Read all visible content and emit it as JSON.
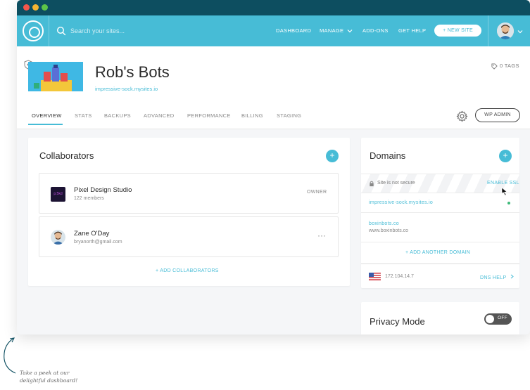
{
  "window_controls": {
    "close_color": "#f2564b",
    "minimize_color": "#f5b531",
    "maximize_color": "#5dc548"
  },
  "colors": {
    "accent": "#47bcd6",
    "titlebar": "#0d4e60",
    "status_online": "#3fba7a"
  },
  "navbar": {
    "search_placeholder": "Search your sites...",
    "links": {
      "dashboard": "DASHBOARD",
      "manage": "MANAGE",
      "addons": "ADD-ONS",
      "get_help": "GET HELP"
    },
    "new_site_label": "+ NEW SITE"
  },
  "site": {
    "title": "Rob's Bots",
    "url": "impressive-sock.mysites.io",
    "tags_label": "0 TAGS"
  },
  "tabs": {
    "overview": "OVERVIEW",
    "stats": "STATS",
    "backups": "BACKUPS",
    "advanced": "ADVANCED",
    "performance": "PERFORMANCE",
    "billing": "BILLING",
    "staging": "STAGING"
  },
  "wp_admin_label": "WP ADMIN",
  "collaborators": {
    "title": "Collaborators",
    "items": [
      {
        "name": "Pixel Design Studio",
        "sub": "122 members",
        "role": "OWNER",
        "badge": "p.5kd"
      },
      {
        "name": "Zane O'Day",
        "sub": "bryanorth@gmail.com",
        "menu": "···"
      }
    ],
    "add_label": "+ ADD COLLABORATORS"
  },
  "domains": {
    "title": "Domains",
    "ssl_status": "Site is not secure",
    "enable_ssl": "ENABLE SSL",
    "primary_domain": "impressive-sock.mysites.io",
    "secondary_domain": "boxinbots.co",
    "secondary_domain_www": "www.boxinbots.co",
    "add_label": "+ ADD ANOTHER DOMAIN",
    "ip": "172.104.14.7",
    "dns_help": "DNS HELP"
  },
  "privacy": {
    "title": "Privacy Mode",
    "toggle_label": "OFF"
  },
  "caption": {
    "line1": "Take a peek at our",
    "line2": "delightful dashboard!"
  }
}
